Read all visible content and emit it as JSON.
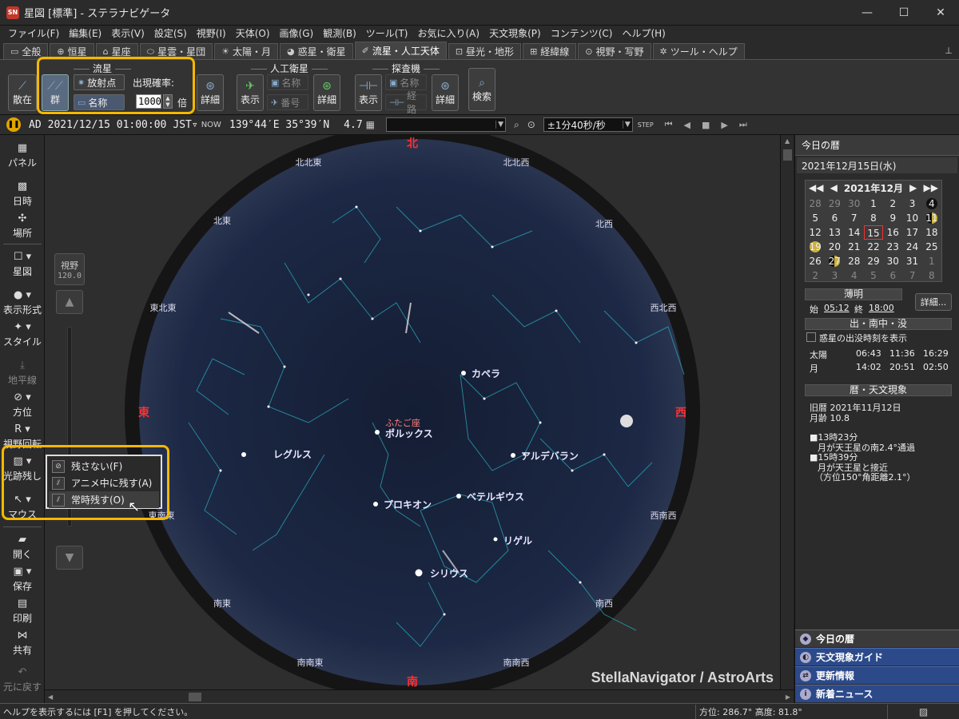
{
  "window": {
    "title": "星図 [標準] - ステラナビゲータ",
    "app_icon": "SN"
  },
  "menu": [
    "ファイル(F)",
    "編集(E)",
    "表示(V)",
    "設定(S)",
    "視野(I)",
    "天体(O)",
    "画像(G)",
    "観測(B)",
    "ツール(T)",
    "お気に入り(A)",
    "天文現象(P)",
    "コンテンツ(C)",
    "ヘルプ(H)"
  ],
  "tabs": [
    {
      "label": "全般",
      "icon": "▭"
    },
    {
      "label": "恒星",
      "icon": "⊕"
    },
    {
      "label": "星座",
      "icon": "⌂"
    },
    {
      "label": "星雲・星団",
      "icon": "⬭"
    },
    {
      "label": "太陽・月",
      "icon": "☀"
    },
    {
      "label": "惑星・衛星",
      "icon": "◕"
    },
    {
      "label": "流星・人工天体",
      "icon": "✐"
    },
    {
      "label": "昼光・地形",
      "icon": "⊡"
    },
    {
      "label": "経緯線",
      "icon": "⊞"
    },
    {
      "label": "視野・写野",
      "icon": "⊙"
    },
    {
      "label": "ツール・ヘルプ",
      "icon": "✲"
    }
  ],
  "ribbon": {
    "meteor_group": "流星",
    "scatter": "散在",
    "shower": "群",
    "radiant": "放射点",
    "name": "名称",
    "frequency_label": "出現確率:",
    "frequency_value": "1000",
    "frequency_unit": "倍",
    "detail": "詳細",
    "satellite_group": "人工衛星",
    "sat_show": "表示",
    "sat_name": "名称",
    "sat_number": "番号",
    "sat_detail": "詳細",
    "probe_group": "探査機",
    "probe_show": "表示",
    "probe_name": "名称",
    "probe_path": "経路",
    "probe_detail": "詳細",
    "search": "検索"
  },
  "timebar": {
    "era": "AD",
    "datetime": "2021/12/15 01:00:00",
    "timezone": "JST▿",
    "now_label": "NOW",
    "location": "139°44′E 35°39′N",
    "limiting_mag": "4.7",
    "search_value": "",
    "step": "±1分40秒/秒",
    "step_label": "STEP"
  },
  "leftbar": [
    {
      "label": "パネル",
      "icon": "▦"
    },
    {
      "label": "日時",
      "icon": "▩"
    },
    {
      "label": "場所",
      "icon": "✣"
    },
    {
      "label": "星図",
      "icon": "☐ ▾"
    },
    {
      "label": "表示形式",
      "icon": "● ▾"
    },
    {
      "label": "スタイル",
      "icon": "✦ ▾"
    },
    {
      "label": "地平線",
      "icon": "⤓"
    },
    {
      "label": "方位",
      "icon": "⊘ ▾"
    },
    {
      "label": "視野回転",
      "icon": "R ▾"
    },
    {
      "label": "光跡残し",
      "icon": "▨ ▾"
    },
    {
      "label": "マウス",
      "icon": "↖ ▾"
    },
    {
      "label": "開く",
      "icon": "▰"
    },
    {
      "label": "保存",
      "icon": "▣ ▾"
    },
    {
      "label": "印刷",
      "icon": "▤"
    },
    {
      "label": "共有",
      "icon": "⋈"
    },
    {
      "label": "元に戻す",
      "icon": "↶"
    }
  ],
  "map": {
    "fov_label": "視野",
    "fov_value": "120.0",
    "credit": "StellaNavigator / AstroArts",
    "directions": {
      "north": "北",
      "south": "南",
      "east": "東",
      "west": "西",
      "nne": "北北東",
      "nnw": "北北西",
      "ne": "北東",
      "nw": "北西",
      "ene": "東北東",
      "wnw": "西北西",
      "ese": "東南東",
      "wsw": "西南西",
      "se": "南東",
      "sw": "南西",
      "sse": "南南東",
      "ssw": "南南西"
    },
    "stars": {
      "capella": "カペラ",
      "pollux": "ポルックス",
      "regulus": "レグルス",
      "aldebaran": "アルデバラン",
      "procyon": "プロキオン",
      "betelgeuse": "ベテルギウス",
      "rigel": "リゲル",
      "sirius": "シリウス"
    },
    "constellation": "ふたご座"
  },
  "popup": {
    "items": [
      "残さない(F)",
      "アニメ中に残す(A)",
      "常時残す(O)"
    ]
  },
  "rightpanel": {
    "title": "今日の暦",
    "date": "2021年12月15日(水)",
    "calendar_month": "2021年12月",
    "calendar_rows": [
      [
        "28",
        "29",
        "30",
        "1",
        "2",
        "3",
        "4"
      ],
      [
        "5",
        "6",
        "7",
        "8",
        "9",
        "10",
        "11"
      ],
      [
        "12",
        "13",
        "14",
        "15",
        "16",
        "17",
        "18"
      ],
      [
        "19",
        "20",
        "21",
        "22",
        "23",
        "24",
        "25"
      ],
      [
        "26",
        "27",
        "28",
        "29",
        "30",
        "31",
        "1"
      ],
      [
        "2",
        "3",
        "4",
        "5",
        "6",
        "7",
        "8"
      ]
    ],
    "twilight_title": "薄明",
    "twilight_start_label": "始",
    "twilight_start": "05:12",
    "twilight_end_label": "終",
    "twilight_end": "18:00",
    "detail_btn": "詳細...",
    "rise_title": "出・南中・没",
    "planet_checkbox": "惑星の出没時刻を表示",
    "sun": {
      "label": "太陽",
      "rise": "06:43",
      "transit": "11:36",
      "set": "16:29"
    },
    "moon": {
      "label": "月",
      "rise": "14:02",
      "transit": "20:51",
      "set": "02:50"
    },
    "calendar_title": "暦・天文現象",
    "lunar_date": "旧暦 2021年11月12日",
    "moon_age": "月齢 10.8",
    "events": [
      {
        "time": "■13時23分",
        "desc": "月が天王星の南2.4°通過"
      },
      {
        "time": "■15時39分",
        "desc": "月が天王星と接近"
      },
      {
        "time": "",
        "desc": "（方位150°角距離2.1°）"
      }
    ],
    "bottom": [
      "今日の暦",
      "天文現象ガイド",
      "更新情報",
      "新着ニュース"
    ]
  },
  "statusbar": {
    "help": "ヘルプを表示するには [F1] を押してください。",
    "coord": "方位: 286.7°  高度: 81.8°"
  }
}
